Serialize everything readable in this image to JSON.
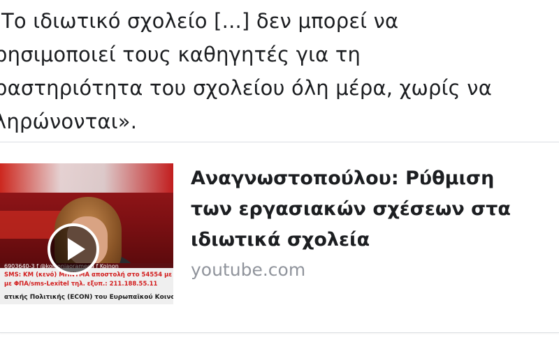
{
  "post": {
    "lines": [
      "Το ιδιωτικό σχολείο [...] δεν μπορεί να",
      "ρησιμοποιεί τους καθηγητές για τη",
      "ραστηριότητα του σχολείου όλη μέρα, χωρίς να",
      "ληρώνονται»."
    ]
  },
  "link_card": {
    "title_lines": [
      "Αναγνωστοπούλου: Ρύθμιση",
      "των εργασιακών σχέσεων στα",
      "ιδιωτικά σχολεία"
    ],
    "domain": "youtube.com",
    "thumbnail": {
      "play_icon": "play-icon",
      "ticker": [
        "6903640-3  f @koinoniaoramega  f Koinon",
        "SMS: KM (κενό) MHNYMA αποστολή στο 54554 με χρέωση",
        "με ΦΠΑ/sms-Lexitel τηλ. εξυπ.: 211.188.55.11",
        "ατικής Πολιτικής (ECON) του Ευρωπαϊκού Κοινοβουλίου, π"
      ]
    }
  },
  "colors": {
    "text": "#1c1e21",
    "domain": "#90949c",
    "ticker_red": "#d21c1c"
  }
}
